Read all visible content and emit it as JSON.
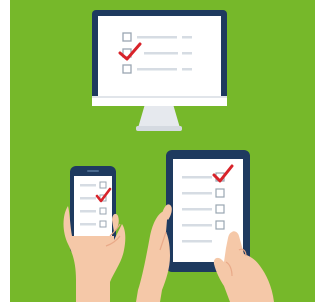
{
  "illustration": {
    "subject": "",
    "colors": {
      "background": "#76b82a",
      "device_frame": "#1e3a5f",
      "screen": "#ffffff",
      "line": "#d6dce3",
      "checkbox": "#9aa6b2",
      "checkmark": "#d8232a",
      "skin": "#f5c8a8",
      "skin_shadow": "#e9a988",
      "monitor_stand": "#e6e9ee"
    },
    "icons": [
      "checkbox-icon",
      "checkmark-icon"
    ],
    "devices": [
      "monitor",
      "smartphone",
      "tablet"
    ]
  }
}
